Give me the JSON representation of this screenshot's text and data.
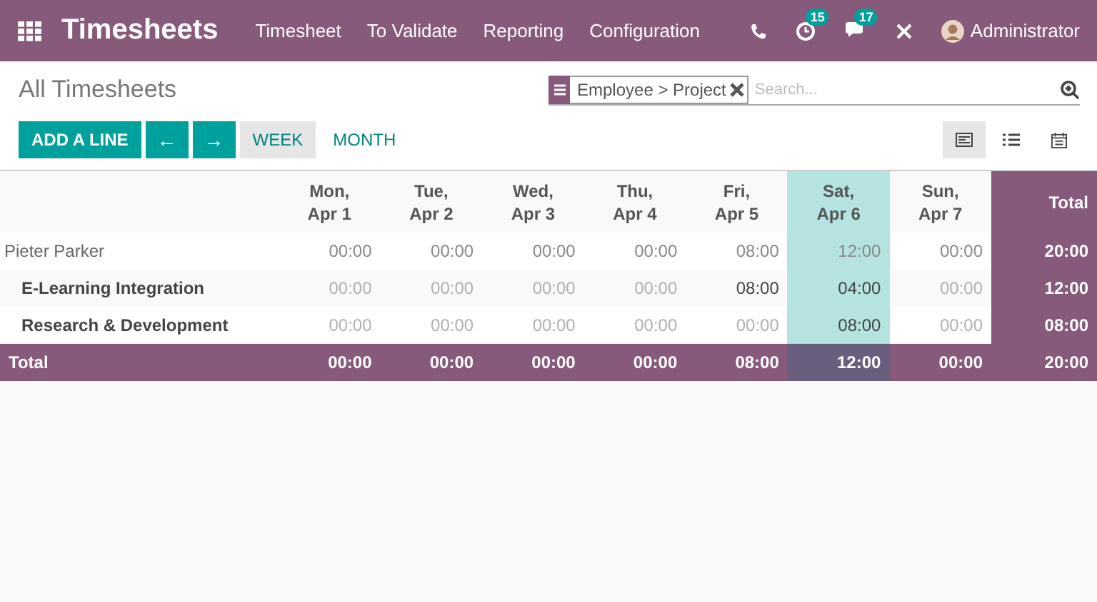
{
  "app_title": "Timesheets",
  "menu": [
    "Timesheet",
    "To Validate",
    "Reporting",
    "Configuration"
  ],
  "systray": {
    "activities_badge": "15",
    "messages_badge": "17",
    "user": "Administrator"
  },
  "breadcrumb": "All Timesheets",
  "search": {
    "facet": "Employee > Project",
    "placeholder": "Search..."
  },
  "buttons": {
    "add": "ADD A LINE",
    "prev": "←",
    "next": "→"
  },
  "ranges": [
    {
      "label": "WEEK",
      "selected": true
    },
    {
      "label": "MONTH",
      "selected": false
    }
  ],
  "views": [
    {
      "kind": "grid",
      "selected": true
    },
    {
      "kind": "list",
      "selected": false
    },
    {
      "kind": "calendar",
      "selected": false
    }
  ],
  "columns": [
    {
      "day": "Mon,",
      "date": "Apr 1",
      "highlighted": false
    },
    {
      "day": "Tue,",
      "date": "Apr 2",
      "highlighted": false
    },
    {
      "day": "Wed,",
      "date": "Apr 3",
      "highlighted": false
    },
    {
      "day": "Thu,",
      "date": "Apr 4",
      "highlighted": false
    },
    {
      "day": "Fri,",
      "date": "Apr 5",
      "highlighted": false
    },
    {
      "day": "Sat,",
      "date": "Apr 6",
      "highlighted": true
    },
    {
      "day": "Sun,",
      "date": "Apr 7",
      "highlighted": false
    }
  ],
  "total_heading": "Total",
  "rows": [
    {
      "kind": "group",
      "label": "Pieter Parker",
      "cells": [
        {
          "value": "00:00",
          "faded": false
        },
        {
          "value": "00:00",
          "faded": false
        },
        {
          "value": "00:00",
          "faded": false
        },
        {
          "value": "00:00",
          "faded": false
        },
        {
          "value": "08:00",
          "faded": false
        },
        {
          "value": "12:00",
          "faded": false
        },
        {
          "value": "00:00",
          "faded": false
        }
      ],
      "total": "20:00"
    },
    {
      "kind": "line",
      "label": "E-Learning Integration",
      "cells": [
        {
          "value": "00:00",
          "faded": true
        },
        {
          "value": "00:00",
          "faded": true
        },
        {
          "value": "00:00",
          "faded": true
        },
        {
          "value": "00:00",
          "faded": true
        },
        {
          "value": "08:00",
          "faded": false
        },
        {
          "value": "04:00",
          "faded": false
        },
        {
          "value": "00:00",
          "faded": true
        }
      ],
      "total": "12:00"
    },
    {
      "kind": "line",
      "label": "Research & Development",
      "cells": [
        {
          "value": "00:00",
          "faded": true
        },
        {
          "value": "00:00",
          "faded": true
        },
        {
          "value": "00:00",
          "faded": true
        },
        {
          "value": "00:00",
          "faded": true
        },
        {
          "value": "00:00",
          "faded": true
        },
        {
          "value": "08:00",
          "faded": false
        },
        {
          "value": "00:00",
          "faded": true
        }
      ],
      "total": "08:00"
    }
  ],
  "footer": {
    "label": "Total",
    "cells": [
      "00:00",
      "00:00",
      "00:00",
      "00:00",
      "08:00",
      "12:00",
      "00:00"
    ],
    "total": "20:00"
  }
}
